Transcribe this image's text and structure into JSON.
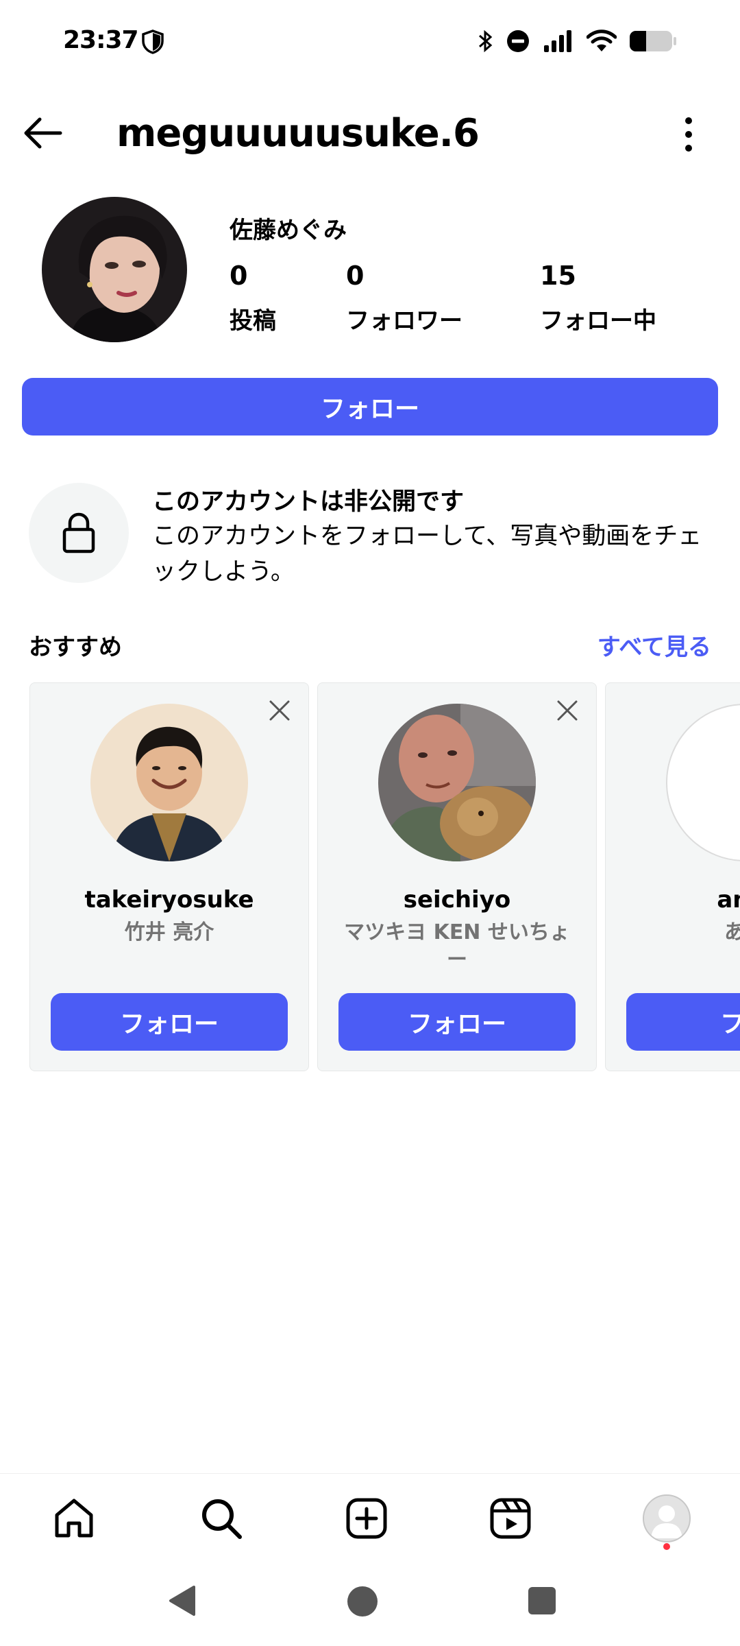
{
  "status_bar": {
    "time": "23:37"
  },
  "header": {
    "username": "meguuuuusuke.6"
  },
  "profile": {
    "display_name": "佐藤めぐみ",
    "stats": [
      {
        "value": "0",
        "label": "投稿"
      },
      {
        "value": "0",
        "label": "フォロワー"
      },
      {
        "value": "15",
        "label": "フォロー中"
      }
    ],
    "follow_label": "フォロー"
  },
  "private_notice": {
    "title": "このアカウントは非公開です",
    "description": "このアカウントをフォローして、写真や動画をチェックしよう。"
  },
  "suggestions": {
    "title": "おすすめ",
    "see_all": "すべて見る",
    "cards": [
      {
        "username": "takeiryosuke",
        "name": "竹井 亮介",
        "follow_label": "フォロー"
      },
      {
        "username": "seichiyo",
        "name": "マツキヨ KEN せいちょー",
        "follow_label": "フォロー"
      },
      {
        "username": "ama",
        "name": "あま",
        "follow_label": "フォ"
      }
    ]
  },
  "colors": {
    "accent": "#4b5cf5",
    "card_bg": "#f4f6f6",
    "secondary_text": "#737373"
  },
  "icons": [
    "back-arrow-icon",
    "more-vertical-icon",
    "lock-icon",
    "close-icon",
    "home-icon",
    "search-icon",
    "create-icon",
    "reels-icon",
    "profile-icon"
  ]
}
